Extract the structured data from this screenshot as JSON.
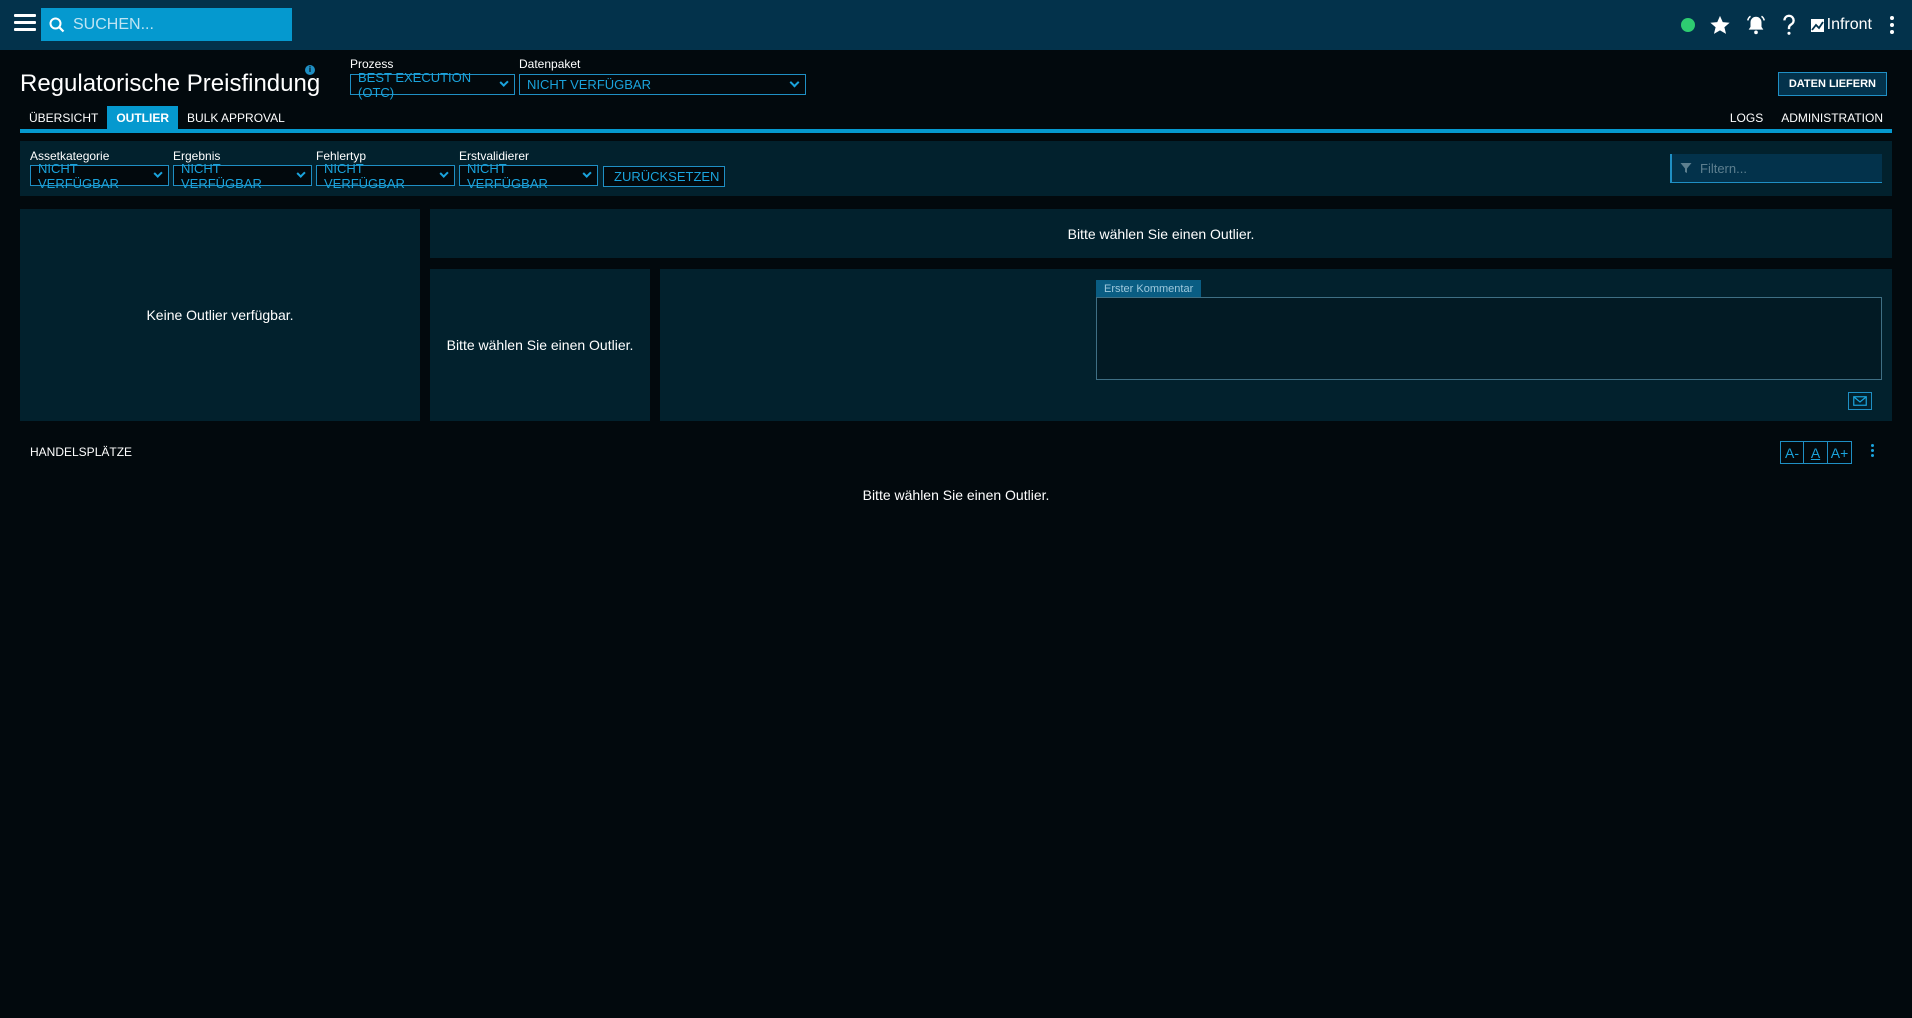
{
  "topbar": {
    "search_placeholder": "SUCHEN...",
    "brand": "Infront",
    "status_color": "#2ecc71"
  },
  "header": {
    "title": "Regulatorische Preisfindung",
    "prozess_label": "Prozess",
    "prozess_value": "BEST EXECUTION (OTC)",
    "datenpaket_label": "Datenpaket",
    "datenpaket_value": "NICHT VERFÜGBAR",
    "daten_liefern": "DATEN LIEFERN"
  },
  "tabs": {
    "left": [
      "ÜBERSICHT",
      "OUTLIER",
      "BULK APPROVAL"
    ],
    "right": [
      "LOGS",
      "ADMINISTRATION"
    ],
    "active": "OUTLIER"
  },
  "filters": {
    "assetkategorie_label": "Assetkategorie",
    "assetkategorie_value": "NICHT VERFÜGBAR",
    "ergebnis_label": "Ergebnis",
    "ergebnis_value": "NICHT VERFÜGBAR",
    "fehlertyp_label": "Fehlertyp",
    "fehlertyp_value": "NICHT VERFÜGBAR",
    "erstvalidierer_label": "Erstvalidierer",
    "erstvalidierer_value": "NICHT VERFÜGBAR",
    "reset_label": "ZURÜCKSETZEN",
    "filter_placeholder": "Filtern..."
  },
  "panels": {
    "no_outlier": "Keine Outlier verfügbar.",
    "select_outlier_top": "Bitte wählen Sie einen Outlier.",
    "select_outlier_left": "Bitte wählen Sie einen Outlier.",
    "comment_label": "Erster Kommentar"
  },
  "handelsplaetze": {
    "title": "HANDELSPLÄTZE",
    "font_decrease": "A-",
    "font_reset": "A",
    "font_increase": "A+",
    "empty": "Bitte wählen Sie einen Outlier."
  },
  "colors": {
    "accent": "#0599cf",
    "topbar": "#03324b",
    "panel": "#02212d",
    "background": "#02090d"
  }
}
